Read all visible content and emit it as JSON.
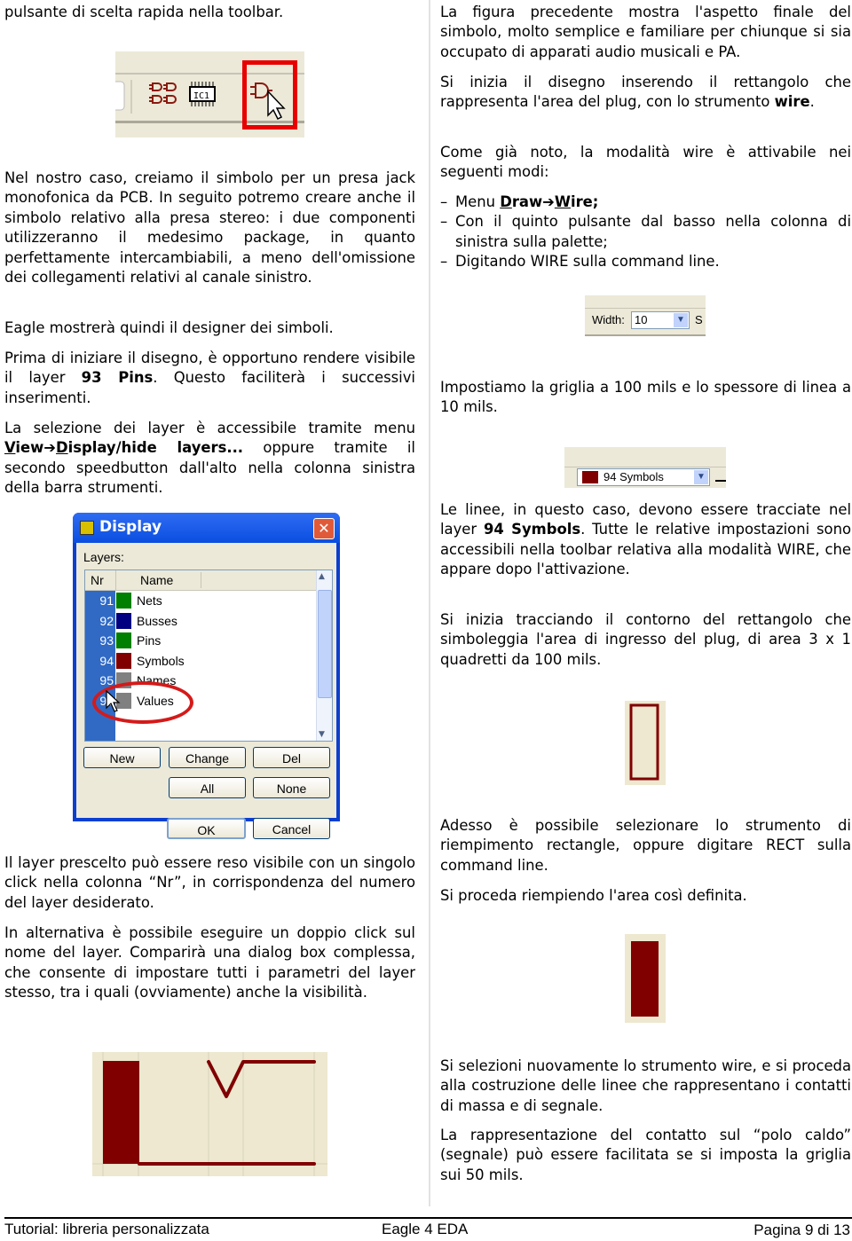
{
  "left_column": {
    "p_top": "pulsante di scelta rapida nella toolbar.",
    "p_symbol": "Nel nostro caso, creiamo il simbolo per un presa jack monofonica da PCB. In seguito potremo creare anche il simbolo relativo alla presa stereo: i due componenti utilizzeranno il medesimo package, in quanto perfettamente intercambiabili, a meno dell'omissione dei collegamenti relativi al canale sinistro.",
    "p_designer": "Eagle mostrerà quindi il designer dei simboli.",
    "p_layer_a": "Prima di iniziare il disegno, è opportuno rendere visibile il layer ",
    "p_layer_bold": "93 Pins",
    "p_layer_b": ". Questo faciliterà i successivi inserimenti.",
    "p_menu_a": "La selezione dei layer è accessibile tramite menu ",
    "p_menu_v": "V",
    "p_menu_iew": "iew",
    "p_menu_arrow": "➔",
    "p_menu_d": "D",
    "p_menu_isplay": "isplay/hide layers...",
    "p_menu_b": " oppure tramite il secondo speedbutton dall'alto nella colonna sinistra della barra strumenti.",
    "p_click": "Il layer prescelto può essere reso visibile con un singolo click nella colonna “Nr”, in corrispondenza del numero del layer desiderato.",
    "p_double": "In alternativa è possibile eseguire un doppio click sul nome del layer. Comparirà una dialog box complessa, che consente di impostare tutti i parametri del layer stesso, tra i quali (ovviamente) anche la visibilità."
  },
  "right_column": {
    "p_figure": "La figura precedente mostra l'aspetto finale del simbolo, molto semplice e familiare per chiunque si sia occupato di apparati audio musicali e PA.",
    "p_start_a": "Si inizia il disegno inserendo il rettangolo che rappresenta l'area del plug, con lo strumento ",
    "p_start_bold": "wire",
    "p_start_b": ".",
    "p_modes": "Come già noto, la modalità wire è attivabile nei seguenti modi:",
    "bullets": [
      {
        "dash": "–",
        "pre": "Menu ",
        "u1": "D",
        "b1": "raw",
        "arrow": "➔",
        "u2": "W",
        "b2": "ire;"
      },
      {
        "dash": "–",
        "text": "Con il quinto pulsante dal basso nella colonna di sinistra sulla palette;"
      },
      {
        "dash": "–",
        "text": "Digitando WIRE sulla command line."
      }
    ],
    "p_grid": "Impostiamo la griglia a 100 mils e lo spessore di linea a 10 mils.",
    "p_lines_a": "Le linee, in questo caso, devono essere tracciate nel layer ",
    "p_lines_bold": "94 Symbols",
    "p_lines_b": ". Tutte le relative impostazioni sono accessibili nella toolbar relativa alla modalità WIRE, che appare dopo l'attivazione.",
    "p_outline": "Si inizia tracciando il contorno del rettangolo che simboleggia l'area di ingresso del plug, di area 3 x 1 quadretti da 100 mils.",
    "p_rect": "Adesso è possibile selezionare lo strumento di riempimento rectangle, oppure digitare RECT sulla command line.",
    "p_fill": "Si proceda riempiendo l'area così definita.",
    "p_wire_again": "Si selezioni nuovamente lo strumento wire, e si proceda alla costruzione delle linee che rappresentano i contatti di massa e di segnale.",
    "p_hot": "La rappresentazione del contatto sul “polo caldo” (segnale) può essere facilitata se si imposta la griglia sui 50 mils."
  },
  "display_dialog": {
    "title": "Display",
    "close": "✕",
    "layers_label": "Layers:",
    "col_nr": "Nr",
    "col_name": "Name",
    "layers": [
      {
        "nr": "91",
        "name": "Nets",
        "color": "#008000"
      },
      {
        "nr": "92",
        "name": "Busses",
        "color": "#000080"
      },
      {
        "nr": "93",
        "name": "Pins",
        "color": "#008000"
      },
      {
        "nr": "94",
        "name": "Symbols",
        "color": "#800000"
      },
      {
        "nr": "95",
        "name": "Names",
        "color": "#808080"
      },
      {
        "nr": "96",
        "name": "Values",
        "color": "#808080"
      }
    ],
    "buttons": {
      "new": "New",
      "change": "Change",
      "del": "Del",
      "all": "All",
      "none": "None",
      "ok": "OK",
      "cancel": "Cancel"
    }
  },
  "width_toolbar": {
    "label": "Width:",
    "value": "10",
    "next_label": "S"
  },
  "layer_toolbar": {
    "value": "94 Symbols",
    "color": "#800000"
  },
  "colors": {
    "symbol_red": "#800000",
    "canvas_bg": "#ede8cf",
    "highlight": "#e80000"
  },
  "footer": {
    "left": "Tutorial: libreria personalizzata",
    "center": "Eagle 4 EDA",
    "right": "Pagina 9 di 13"
  }
}
